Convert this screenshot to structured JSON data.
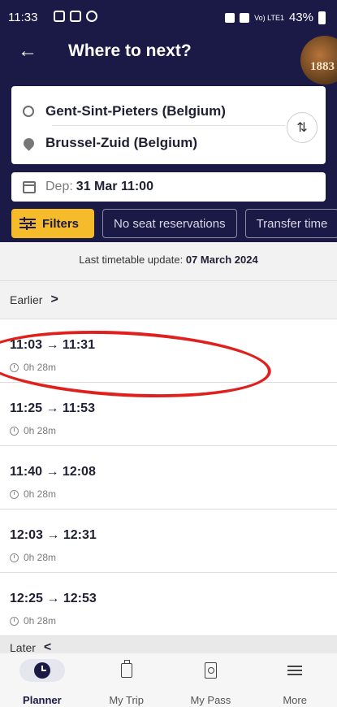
{
  "status_bar": {
    "time": "11:33",
    "signal": "Vo) LTE1",
    "battery": "43%"
  },
  "header": {
    "title": "Where to next?",
    "avatar_text": "1883"
  },
  "route": {
    "from": "Gent-Sint-Pieters (Belgium)",
    "to": "Brussel-Zuid (Belgium)",
    "swap_symbol": "⇅"
  },
  "departure": {
    "label": "Dep:",
    "value": "31 Mar 11:00"
  },
  "filters": {
    "primary_label": "Filters",
    "chips": [
      "No seat reservations",
      "Transfer time"
    ]
  },
  "timetable": {
    "update_prefix": "Last timetable update:",
    "update_date": "07 March 2024",
    "earlier_label": "Earlier",
    "later_label": "Later",
    "journeys": [
      {
        "time": "11:03 → 11:31",
        "duration": "0h 28m"
      },
      {
        "time": "11:25 → 11:53",
        "duration": "0h 28m"
      },
      {
        "time": "11:40 → 12:08",
        "duration": "0h 28m"
      },
      {
        "time": "12:03 → 12:31",
        "duration": "0h 28m"
      },
      {
        "time": "12:25 → 12:53",
        "duration": "0h 28m"
      }
    ]
  },
  "nav": {
    "items": [
      {
        "label": "Planner",
        "icon": "clock-icon",
        "active": true
      },
      {
        "label": "My Trip",
        "icon": "luggage-icon",
        "active": false
      },
      {
        "label": "My Pass",
        "icon": "pass-icon",
        "active": false
      },
      {
        "label": "More",
        "icon": "menu-icon",
        "active": false
      }
    ]
  },
  "colors": {
    "header_bg": "#1b1a46",
    "accent_yellow": "#f5bb2a",
    "annotation_red": "#e0201c"
  }
}
